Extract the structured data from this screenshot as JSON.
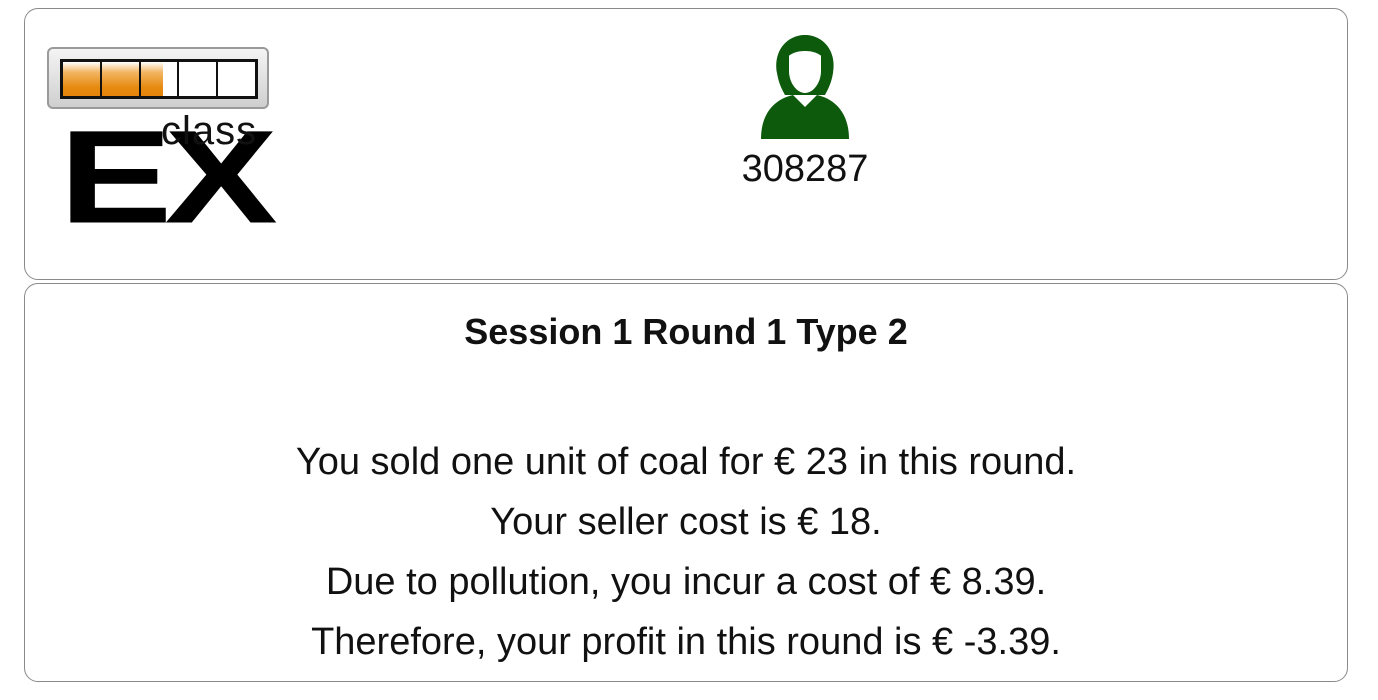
{
  "header": {
    "logo": {
      "brand_text": "class",
      "brand_letters": "EX",
      "progress": {
        "segments": 5,
        "filled_segments": 2.6
      },
      "accent_color": "#e5840b"
    },
    "user": {
      "icon": "user-avatar-icon",
      "icon_color": "#0d5a0d",
      "id": "308287"
    }
  },
  "content": {
    "title": "Session 1 Round 1 Type 2",
    "lines": [
      "You sold one unit of coal for € 23 in this round.",
      "Your seller cost is € 18.",
      "Due to pollution, you incur a cost of € 8.39.",
      "Therefore, your profit in this round is € -3.39."
    ]
  }
}
